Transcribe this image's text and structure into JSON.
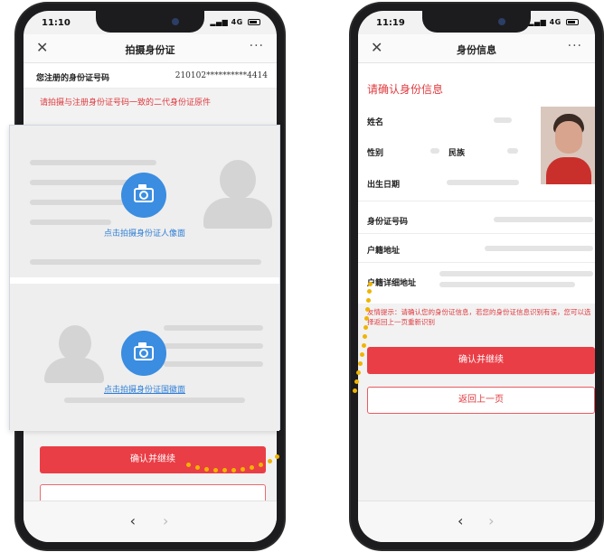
{
  "left_phone": {
    "status": {
      "time": "11:10",
      "signal": "4G"
    },
    "nav": {
      "close_icon": "close-icon",
      "title": "拍摄身份证",
      "more_icon": "more-icon"
    },
    "registered_id": {
      "label": "您注册的身份证号码",
      "value": "210102**********4414"
    },
    "hint": "请拍摄与注册身份证号码一致的二代身份证原件",
    "upload_front": {
      "caption": "点击拍摄身份证人像面",
      "icon": "camera-icon"
    },
    "upload_back": {
      "caption": "点击拍摄身份证国徽面",
      "icon": "camera-icon"
    },
    "confirm_label": "确认并继续"
  },
  "right_phone": {
    "status": {
      "time": "11:19",
      "signal": "4G"
    },
    "nav": {
      "close_icon": "close-icon",
      "title": "身份信息",
      "more_icon": "more-icon"
    },
    "section_title": "请确认身份信息",
    "fields": {
      "name": "姓名",
      "gender": "性别",
      "ethnicity": "民族",
      "birth": "出生日期",
      "id_number": "身份证号码",
      "household": "户籍地址",
      "household_detail": "户籍详细地址"
    },
    "note": "友情提示：请确认您的身份证信息，若您的身份证信息识别有误，您可以选择返回上一页重新识别",
    "confirm_label": "确认并继续",
    "back_label": "返回上一页"
  },
  "colors": {
    "accent_red": "#ea3e46",
    "link_blue": "#2f7fd6",
    "connector_yellow": "#f0b400"
  }
}
